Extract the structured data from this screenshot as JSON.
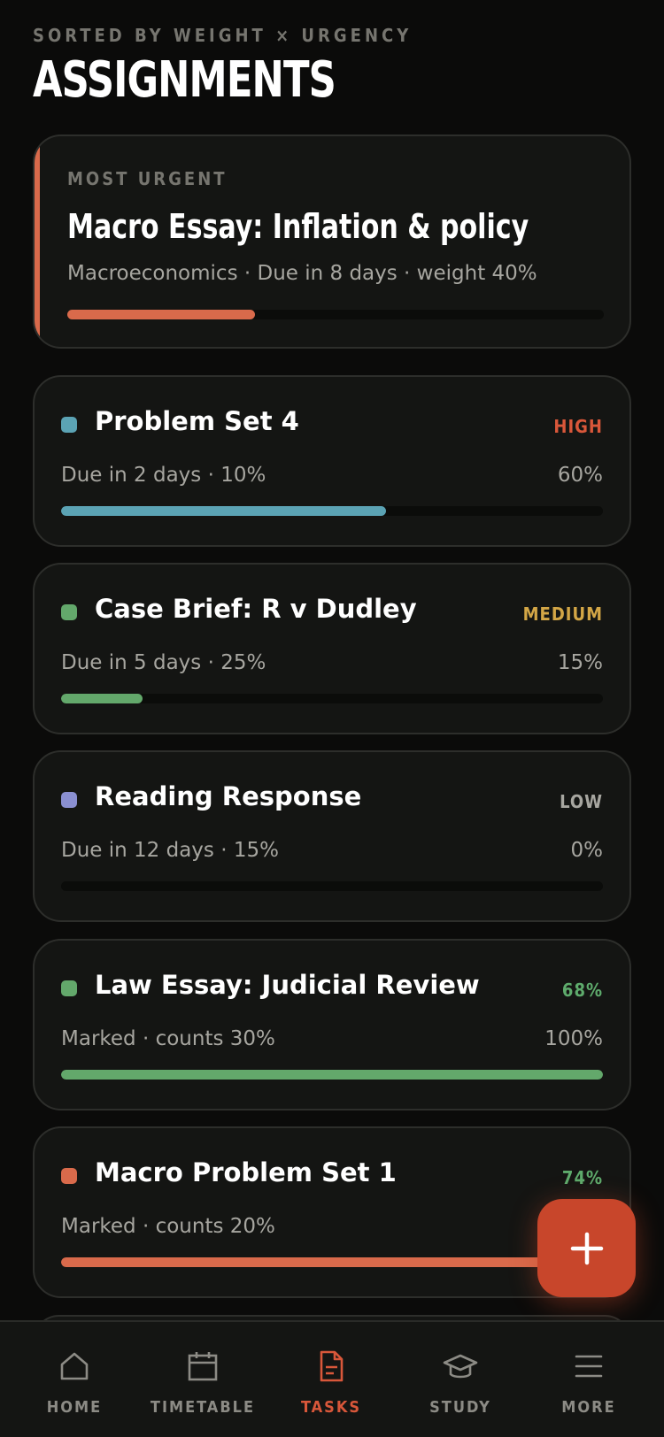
{
  "header": {
    "subtitle": "SORTED BY WEIGHT × URGENCY",
    "title": "ASSIGNMENTS"
  },
  "urgent": {
    "label": "MOST URGENT",
    "title": "Macro Essay: Inflation & policy",
    "meta": "Macroeconomics · Due in 8 days · weight 40%",
    "progress": 0.35,
    "color": "#d96a4b"
  },
  "tasks": [
    {
      "name": "Problem Set 4",
      "tag": "HIGH",
      "tag_color": "#d9573a",
      "meta": "Due in 2 days · 10%",
      "percent": "60%",
      "progress": 0.6,
      "color": "#5ba3b4"
    },
    {
      "name": "Case Brief: R v Dudley",
      "tag": "MEDIUM",
      "tag_color": "#d3a646",
      "meta": "Due in 5 days · 25%",
      "percent": "15%",
      "progress": 0.15,
      "color": "#63a86b"
    },
    {
      "name": "Reading Response",
      "tag": "LOW",
      "tag_color": "#a7a6a0",
      "meta": "Due in 12 days · 15%",
      "percent": "0%",
      "progress": 0.0,
      "color": "#8a8fd1"
    },
    {
      "name": "Law Essay: Judicial Review",
      "tag": "68%",
      "tag_color": "#5eab6c",
      "meta": "Marked · counts 30%",
      "percent": "100%",
      "progress": 1.0,
      "color": "#63a86b"
    },
    {
      "name": "Macro Problem Set 1",
      "tag": "74%",
      "tag_color": "#5eab6c",
      "meta": "Marked · counts 20%",
      "percent": "",
      "progress": 1.0,
      "color": "#d96a4b"
    }
  ],
  "fab": {
    "icon": "plus-icon"
  },
  "nav": {
    "items": [
      {
        "label": "HOME",
        "icon": "home-icon",
        "active": false
      },
      {
        "label": "TIMETABLE",
        "icon": "calendar-icon",
        "active": false
      },
      {
        "label": "TASKS",
        "icon": "document-icon",
        "active": true
      },
      {
        "label": "STUDY",
        "icon": "graduation-cap-icon",
        "active": false
      },
      {
        "label": "MORE",
        "icon": "menu-icon",
        "active": false
      }
    ]
  }
}
